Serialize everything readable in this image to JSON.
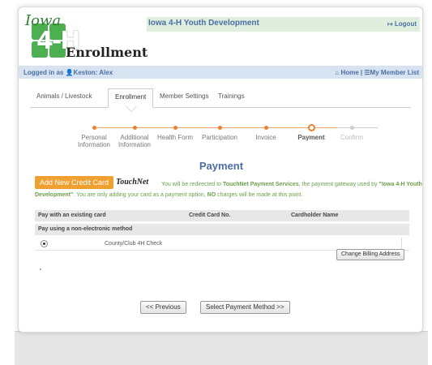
{
  "header": {
    "logo_iowa": "Iowa",
    "logo_4h": "4-H",
    "logo_enrollment": "Enrollment",
    "app_title": "Iowa 4-H Youth Development",
    "logout_label": "Logout"
  },
  "userbar": {
    "logged_in_prefix": "Logged in as",
    "user_name": "Keston: Alex",
    "home_label": "Home",
    "member_list_label": "My Member List"
  },
  "tabs": [
    {
      "label": "Animals / Livestock",
      "active": false
    },
    {
      "label": "Enrollment",
      "active": true
    },
    {
      "label": "Member Settings",
      "active": false
    },
    {
      "label": "Trainings",
      "active": false
    }
  ],
  "steps": [
    {
      "label": "Personal Information",
      "state": "done"
    },
    {
      "label": "Additional Information",
      "state": "done"
    },
    {
      "label": "Health Form",
      "state": "done"
    },
    {
      "label": "Participation",
      "state": "done"
    },
    {
      "label": "Invoice",
      "state": "done"
    },
    {
      "label": "Payment",
      "state": "current"
    },
    {
      "label": "Confirm",
      "state": "future"
    }
  ],
  "page_title": "Payment",
  "add_card_label": "Add New Credit Card",
  "touchnet_logo": "TouchNet",
  "notice": {
    "part1": "You will be redirected to ",
    "provider": "TouchNet Payment Services",
    "part2": ", the payment gateway used by ",
    "org": "\"Iowa 4-H Youth Development\"",
    "part3": ". You are only adding your card as a payment option, ",
    "emph": "NO",
    "part4": " charges will be made at this point."
  },
  "table": {
    "headers": [
      "Pay with an existing card",
      "Credit Card No.",
      "Cardholder Name"
    ],
    "non_electronic_label": "Pay using a non-electronic method",
    "rows": [
      {
        "label": "County/Club 4H Check",
        "selected": true
      }
    ]
  },
  "change_billing_label": "Change Billing Address",
  "previous_label": "<< Previous",
  "select_method_label": "Select Payment Method >>",
  "colors": {
    "accent": "#ee7f2d",
    "link": "#4a6fa5",
    "notice": "#6ba04a",
    "button_orange": "#f0a030"
  }
}
